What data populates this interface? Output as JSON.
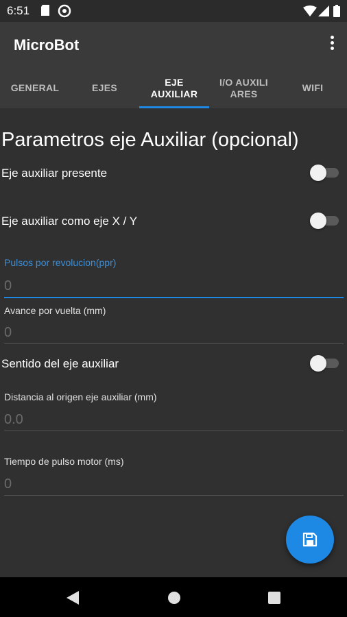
{
  "status_bar": {
    "time": "6:51"
  },
  "app": {
    "title": "MicroBot"
  },
  "tabs": [
    {
      "label": "GENERAL"
    },
    {
      "label": "EJES"
    },
    {
      "label": "EJE\nAUXILIAR"
    },
    {
      "label": "I/O AUXILI\nARES"
    },
    {
      "label": "WIFI"
    }
  ],
  "active_tab": "EJE AUXILIAR",
  "main": {
    "heading": "Parametros eje Auxiliar (opcional)",
    "switches": [
      {
        "label": "Eje auxiliar presente",
        "on": false
      },
      {
        "label": "Eje auxiliar como eje X / Y",
        "on": false
      },
      {
        "label": "Sentido del eje auxiliar",
        "on": false
      }
    ],
    "fields": [
      {
        "label": "Pulsos por revolucion(ppr)",
        "value": "0",
        "focused": true
      },
      {
        "label": "Avance por vuelta (mm)",
        "value": "0"
      },
      {
        "label": "Distancia al origen eje auxiliar (mm)",
        "value": "0.0"
      },
      {
        "label": "Tiempo de pulso motor (ms)",
        "value": "0"
      }
    ]
  },
  "fab": {
    "icon": "save-icon"
  },
  "colors": {
    "accent": "#1e88e5",
    "background": "#303030",
    "appbar": "#3a3a3a"
  }
}
